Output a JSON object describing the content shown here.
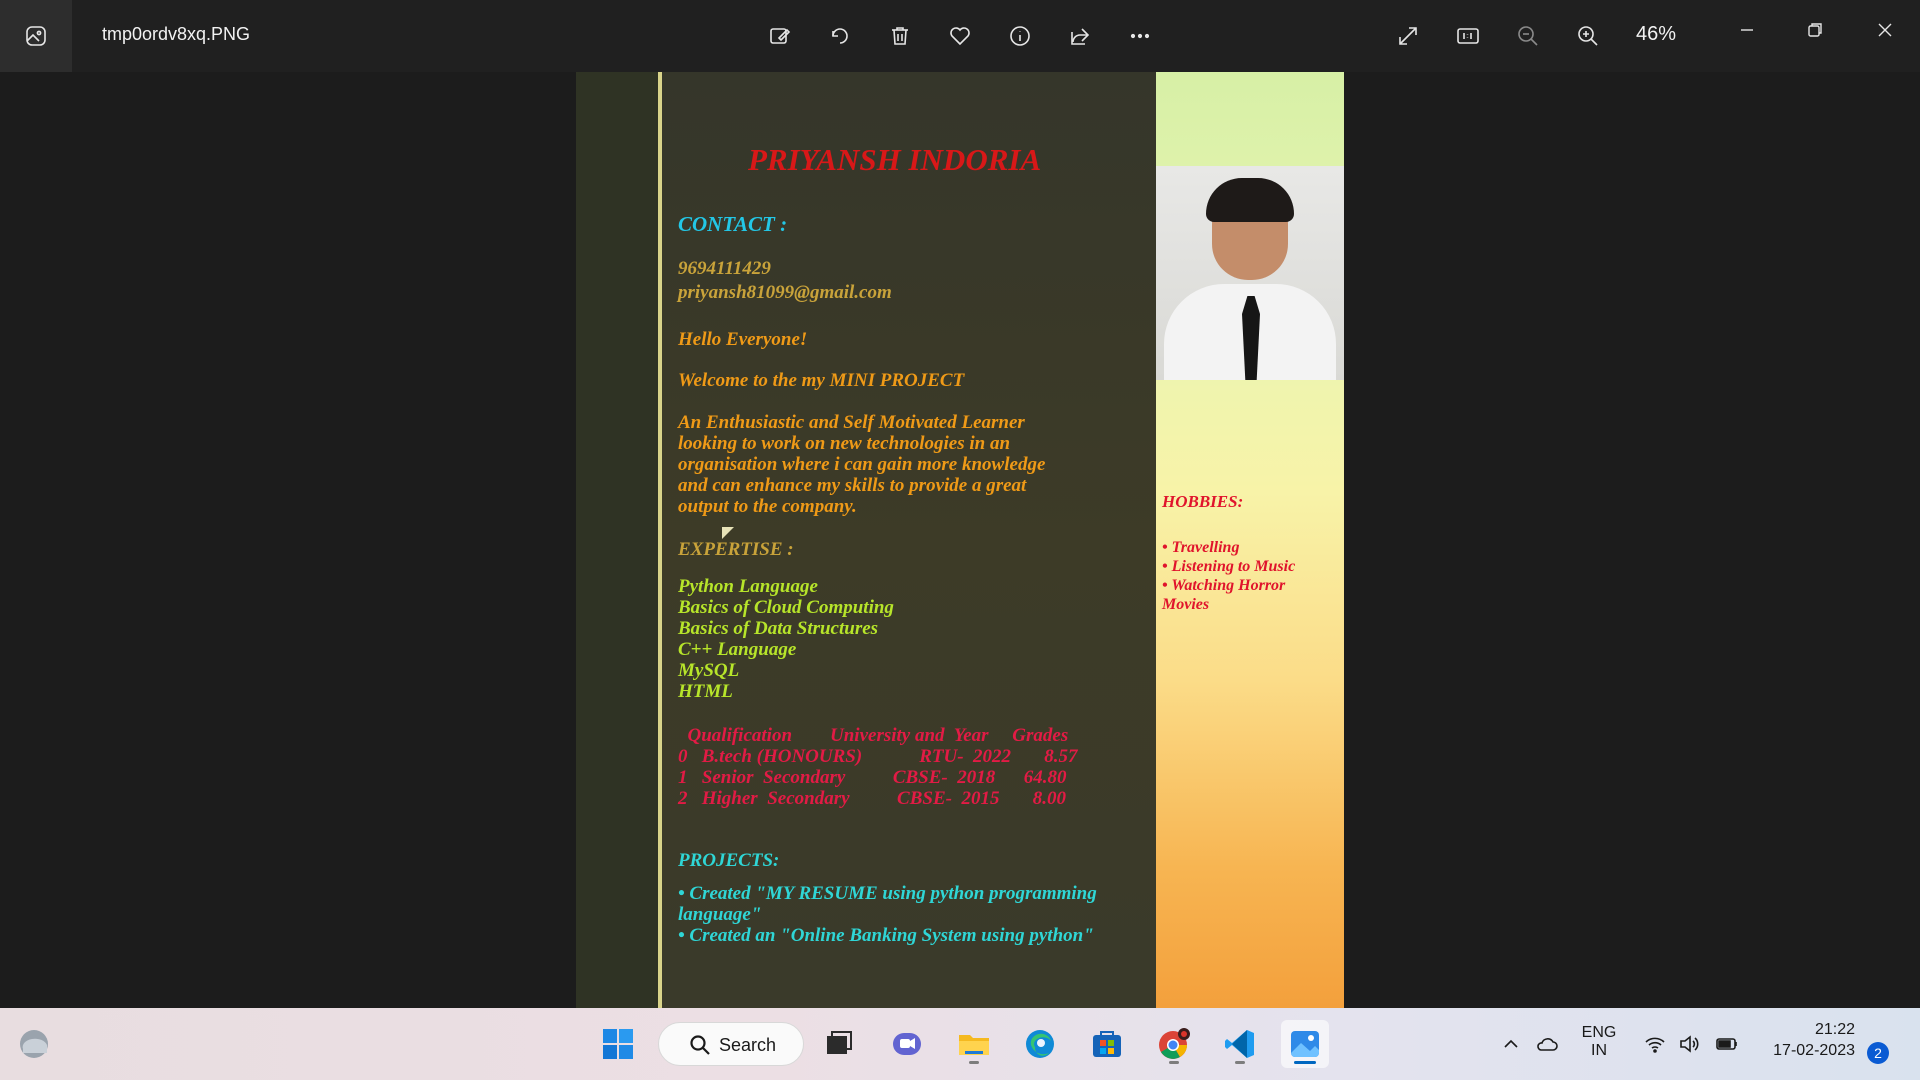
{
  "window": {
    "filename": "tmp0ordv8xq.PNG",
    "zoom": "46%"
  },
  "toolbar": {
    "icons": [
      "edit-image-icon",
      "rotate-icon",
      "delete-icon",
      "favorite-icon",
      "info-icon",
      "share-icon",
      "more-icon"
    ],
    "right_icons": [
      "fullscreen-icon",
      "actual-size-icon",
      "zoom-out-icon",
      "zoom-in-icon"
    ]
  },
  "resume": {
    "name": "PRIYANSH INDORIA",
    "contact_heading": "CONTACT :",
    "phone": "9694111429",
    "email": "priyansh81099@gmail.com",
    "greeting": "Hello Everyone!",
    "welcome": "Welcome to the my MINI PROJECT",
    "summary": "An Enthusiastic and Self Motivated Learner\nlooking to work on new technologies in an\norganisation where i can gain more knowledge\nand can enhance my skills to provide a great\noutput to the company.",
    "expertise_heading": "EXPERTISE :",
    "expertise": [
      "Python Language",
      "Basics of Cloud Computing",
      "Basics of Data Structures",
      "C++ Language",
      "MySQL",
      "HTML"
    ],
    "qualification_header": "  Qualification        University and  Year     Grades",
    "qualification_rows": [
      "0   B.tech (HONOURS)            RTU-  2022       8.57",
      "1   Senior  Secondary          CBSE-  2018      64.80",
      "2   Higher  Secondary          CBSE-  2015       8.00"
    ],
    "projects_heading": "PROJECTS:",
    "projects": [
      "• Created \"MY RESUME  using python programming\n    language\"",
      "• Created an \"Online Banking System using python\""
    ],
    "hobbies_heading": "HOBBIES:",
    "hobbies": [
      "• Travelling",
      "•  Listening to Music",
      "•  Watching Horror\n Movies"
    ]
  },
  "taskbar": {
    "search_label": "Search",
    "language_top": "ENG",
    "language_bottom": "IN",
    "time": "21:22",
    "date": "17-02-2023",
    "notification_count": "2",
    "apps": [
      "start-icon",
      "task-view-icon",
      "chat-icon",
      "file-explorer-icon",
      "edge-icon",
      "store-icon",
      "chrome-icon",
      "vscode-icon",
      "photos-icon"
    ]
  }
}
